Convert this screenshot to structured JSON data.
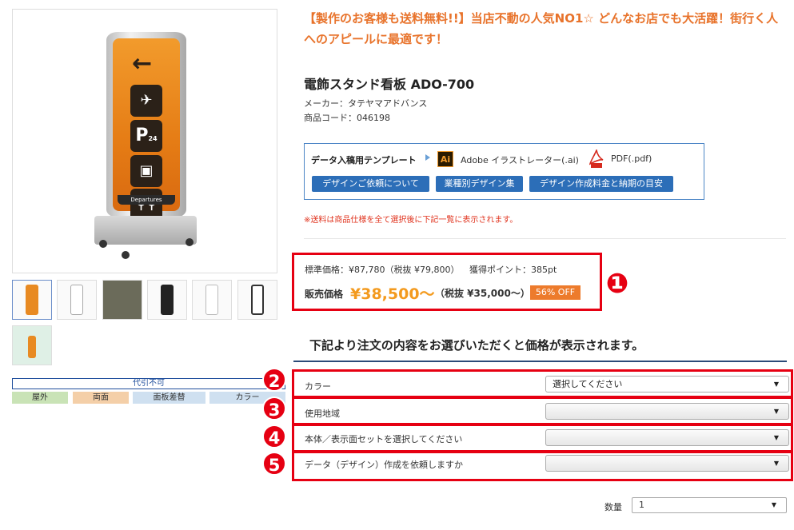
{
  "headline": "【製作のお客様も送料無料!!】当店不動の人気NO1☆ どんなお店でも大活躍！街行く人へのアピールに最適です！",
  "product": {
    "title": "電飾スタンド看板 ADO-700",
    "maker": "メーカー：タテヤマアドバンス",
    "code": "商品コード：046198",
    "sign_footer_text": "Departures",
    "sign_p_sub": "24"
  },
  "tags": {
    "no_change": "代引不可",
    "items": [
      "屋外",
      "両面",
      "面板差替",
      "カラー"
    ],
    "colors": [
      "#c9e3b6",
      "#f4cfa8",
      "#cfe0f0",
      "#cfe0f0"
    ]
  },
  "template": {
    "label": "データ入稿用テンプレート",
    "ai_icon": "Ai",
    "ai_label": "Adobe イラストレーター(.ai)",
    "pdf_label": "PDF(.pdf)",
    "buttons": [
      "デザインご依頼について",
      "業種別デザイン集",
      "デザイン作成料金と納期の目安"
    ]
  },
  "shipping_note": "※送料は商品仕様を全て選択後に下記一覧に表示されます。",
  "price": {
    "standard": "標準価格：¥87,780（税抜 ¥79,800）",
    "points": "獲得ポイント：385pt",
    "sale_label": "販売価格",
    "sale_price": "¥38,500～",
    "tax_price": "（税抜 ¥35,000～）",
    "off_badge": "56% OFF"
  },
  "badges": [
    "❶",
    "2",
    "3",
    "4",
    "5"
  ],
  "select_heading": "下記より注文の内容をお選びいただくと価格が表示されます。",
  "options": [
    {
      "label": "カラー",
      "value": "選択してください"
    },
    {
      "label": "使用地域",
      "value": ""
    },
    {
      "label": "本体／表示面セットを選択してください",
      "value": ""
    },
    {
      "label": "データ（デザイン）作成を依頼しますか",
      "value": ""
    }
  ],
  "quantity": {
    "label": "数量",
    "value": "1"
  },
  "colors": {
    "accent_orange": "#e8732b",
    "highlight_red": "#e60012",
    "button_blue": "#2c6eb8"
  }
}
